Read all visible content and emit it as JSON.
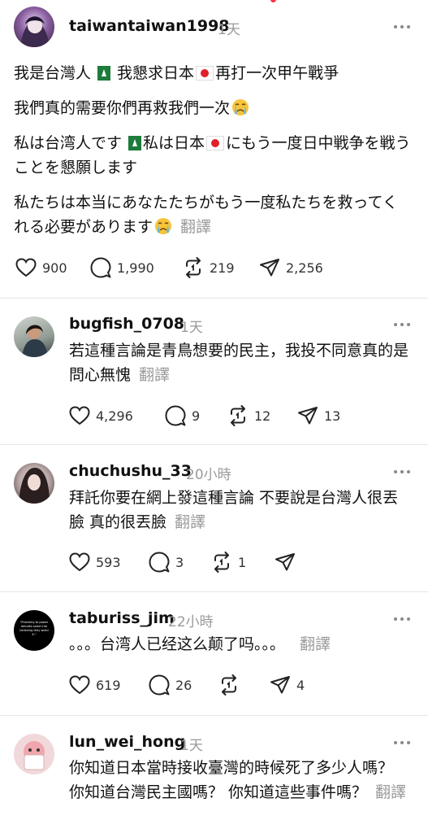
{
  "main_post": {
    "username": "taiwantaiwan1998",
    "time": "1天",
    "lines": [
      {
        "text": "我是台灣人",
        "flag1": "green-flag",
        "text2": " 我懇求日本",
        "flag2": "japan-flag",
        "text3": "再打一次甲午戰爭"
      },
      {
        "text": "我們真的需要你們再救我們一次"
      },
      {
        "text": "私は台湾人です",
        "text2": "私は日本",
        "text3": "にもう一度日中戦争を戦うことを懇願します"
      },
      {
        "text": "私たちは本当にあなたたちがもう一度私たちを救ってくれる必要があります"
      }
    ],
    "translate": "翻譯",
    "stats": {
      "likes": "900",
      "comments": "1,990",
      "reposts": "219",
      "shares": "2,256"
    }
  },
  "replies": [
    {
      "username": "bugfish_0708",
      "time": "1天",
      "text": "若這種言論是青鳥想要的民主，我投不同意真的是問心無愧",
      "translate": "翻譯",
      "stats": {
        "likes": "4,296",
        "comments": "9",
        "reposts": "12",
        "shares": "13"
      }
    },
    {
      "username": "chuchushu_33",
      "time": "20小時",
      "text": "拜託你要在網上發這種言論 不要說是台灣人很丟臉 真的很丟臉",
      "translate": "翻譯",
      "stats": {
        "likes": "593",
        "comments": "3",
        "reposts": "1",
        "shares": ""
      }
    },
    {
      "username": "taburiss_jim",
      "time": "22小時",
      "text": "。。。台湾人已经这么颠了吗。。。",
      "translate": "翻譯",
      "avatar_text": "\"Proximity to power deludes some into believing they wield it.\"",
      "stats": {
        "likes": "619",
        "comments": "26",
        "reposts": "",
        "shares": "4"
      }
    },
    {
      "username": "lun_wei_hong",
      "time": "1天",
      "text": "你知道日本當時接收臺灣的時候死了多少人嗎？ 你知道台灣民主國嗎？ 你知道這些事件嗎？",
      "translate": "翻譯"
    }
  ],
  "icons": [
    "heart-icon",
    "comment-icon",
    "repost-icon",
    "share-icon",
    "more-icon"
  ],
  "colors": {
    "muted": "#9a9a9a",
    "flag_green": "#1e7b3c",
    "flag_red": "#e0202a"
  }
}
